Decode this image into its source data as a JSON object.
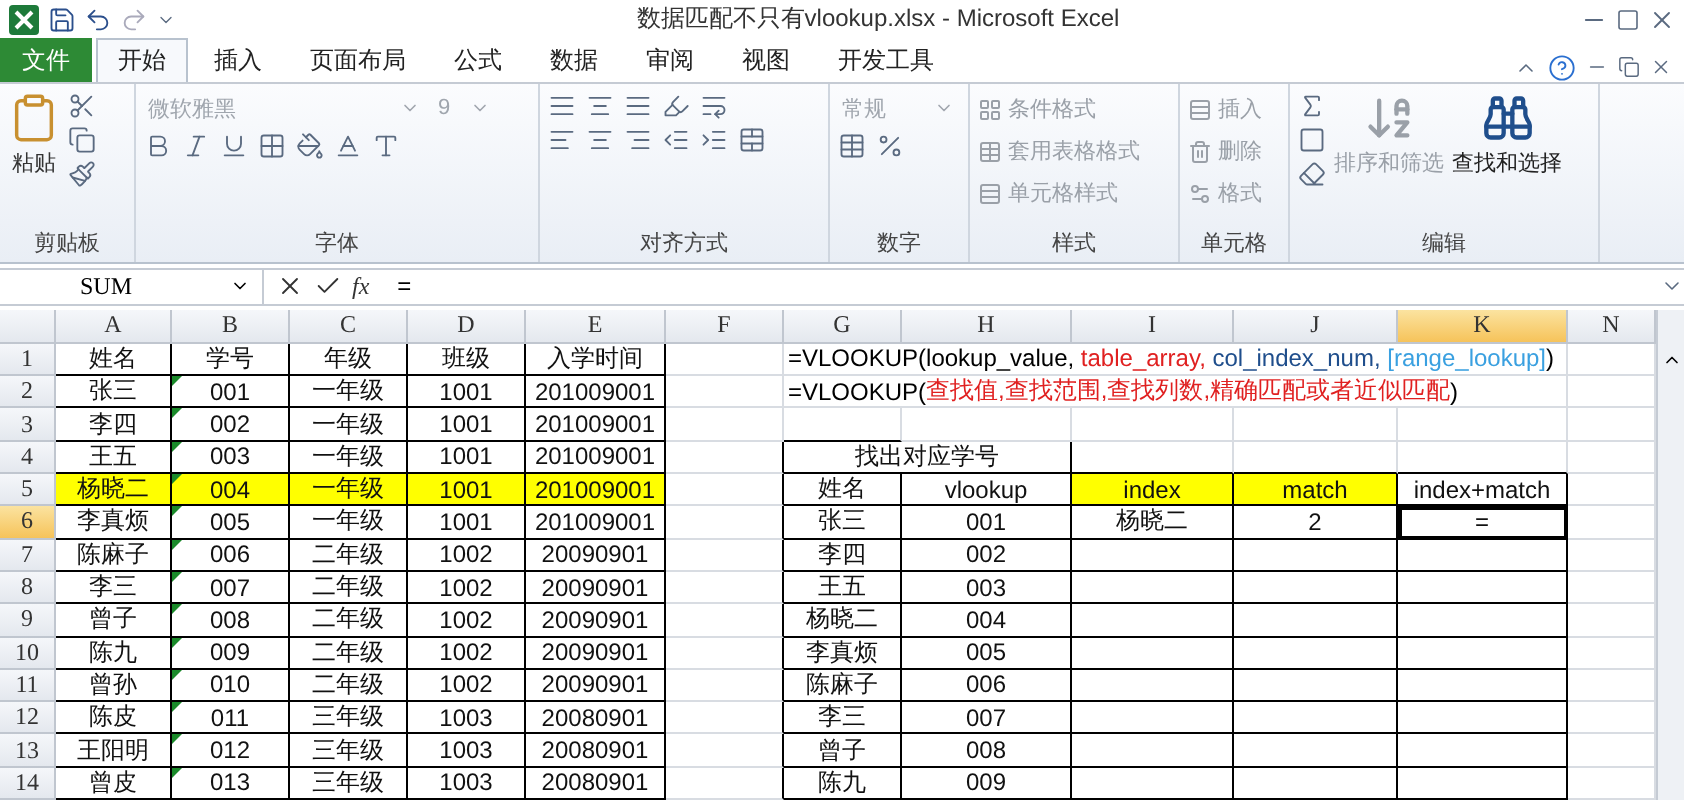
{
  "window": {
    "title": "数据匹配不只有vlookup.xlsx - Microsoft Excel"
  },
  "tabs": [
    {
      "label": "文件",
      "kind": "file",
      "selected": false
    },
    {
      "label": "开始",
      "kind": "tab",
      "selected": true
    },
    {
      "label": "插入",
      "kind": "tab",
      "selected": false
    },
    {
      "label": "页面布局",
      "kind": "tab",
      "selected": false
    },
    {
      "label": "公式",
      "kind": "tab",
      "selected": false
    },
    {
      "label": "数据",
      "kind": "tab",
      "selected": false
    },
    {
      "label": "审阅",
      "kind": "tab",
      "selected": false
    },
    {
      "label": "视图",
      "kind": "tab",
      "selected": false
    },
    {
      "label": "开发工具",
      "kind": "tab",
      "selected": false
    }
  ],
  "ribbon": [
    {
      "kind": "clipboard",
      "label": "剪贴板",
      "paste": "粘贴"
    },
    {
      "kind": "font",
      "label": "字体",
      "font_name": "微软雅黑",
      "font_size": "9"
    },
    {
      "kind": "alignment",
      "label": "对齐方式"
    },
    {
      "kind": "number",
      "label": "数字",
      "format": "常规"
    },
    {
      "kind": "list",
      "label": "样式",
      "items": [
        "条件格式",
        "套用表格格式",
        "单元格样式"
      ]
    },
    {
      "kind": "list",
      "label": "单元格",
      "items": [
        "插入",
        "删除",
        "格式"
      ]
    },
    {
      "kind": "editing",
      "label": "编辑",
      "items": [
        "排序和筛选",
        "查找和选择"
      ]
    }
  ],
  "formula_bar": {
    "name_box": "SUM",
    "insert_function": "fx",
    "value": "="
  },
  "columns": [
    {
      "label": "A",
      "selected": false
    },
    {
      "label": "B",
      "selected": false
    },
    {
      "label": "C",
      "selected": false
    },
    {
      "label": "D",
      "selected": false
    },
    {
      "label": "E",
      "selected": false
    },
    {
      "label": "F",
      "selected": false
    },
    {
      "label": "G",
      "selected": false
    },
    {
      "label": "H",
      "selected": false
    },
    {
      "label": "I",
      "selected": false
    },
    {
      "label": "J",
      "selected": false
    },
    {
      "label": "K",
      "selected": true
    },
    {
      "label": "N",
      "selected": false
    }
  ],
  "row_headers": [
    {
      "label": "1",
      "selected": false
    },
    {
      "label": "2",
      "selected": false
    },
    {
      "label": "3",
      "selected": false
    },
    {
      "label": "4",
      "selected": false
    },
    {
      "label": "5",
      "selected": false
    },
    {
      "label": "6",
      "selected": true
    },
    {
      "label": "7",
      "selected": false
    },
    {
      "label": "8",
      "selected": false
    },
    {
      "label": "9",
      "selected": false
    },
    {
      "label": "10",
      "selected": false
    },
    {
      "label": "11",
      "selected": false
    },
    {
      "label": "12",
      "selected": false
    },
    {
      "label": "13",
      "selected": false
    },
    {
      "label": "14",
      "selected": false
    }
  ],
  "left_table": [
    {
      "cells": [
        "姓名",
        "学号",
        "年级",
        "班级",
        "入学时间"
      ],
      "highlighted": false,
      "flagged": false
    },
    {
      "cells": [
        "张三",
        "001",
        "一年级",
        "1001",
        "201009001"
      ],
      "highlighted": false,
      "flagged": true
    },
    {
      "cells": [
        "李四",
        "002",
        "一年级",
        "1001",
        "201009001"
      ],
      "highlighted": false,
      "flagged": true
    },
    {
      "cells": [
        "王五",
        "003",
        "一年级",
        "1001",
        "201009001"
      ],
      "highlighted": false,
      "flagged": true
    },
    {
      "cells": [
        "杨晓二",
        "004",
        "一年级",
        "1001",
        "201009001"
      ],
      "highlighted": true,
      "flagged": true
    },
    {
      "cells": [
        "李真烦",
        "005",
        "一年级",
        "1001",
        "201009001"
      ],
      "highlighted": false,
      "flagged": true
    },
    {
      "cells": [
        "陈麻子",
        "006",
        "二年级",
        "1002",
        "20090901"
      ],
      "highlighted": false,
      "flagged": true
    },
    {
      "cells": [
        "李三",
        "007",
        "二年级",
        "1002",
        "20090901"
      ],
      "highlighted": false,
      "flagged": true
    },
    {
      "cells": [
        "曾子",
        "008",
        "二年级",
        "1002",
        "20090901"
      ],
      "highlighted": false,
      "flagged": true
    },
    {
      "cells": [
        "陈九",
        "009",
        "二年级",
        "1002",
        "20090901"
      ],
      "highlighted": false,
      "flagged": true
    },
    {
      "cells": [
        "曾孙",
        "010",
        "二年级",
        "1002",
        "20090901"
      ],
      "highlighted": false,
      "flagged": true
    },
    {
      "cells": [
        "陈皮",
        "011",
        "三年级",
        "1003",
        "20080901"
      ],
      "highlighted": false,
      "flagged": true
    },
    {
      "cells": [
        "王阳明",
        "012",
        "三年级",
        "1003",
        "20080901"
      ],
      "highlighted": false,
      "flagged": true
    },
    {
      "cells": [
        "曾皮",
        "013",
        "三年级",
        "1003",
        "20080901"
      ],
      "highlighted": false,
      "flagged": true
    }
  ],
  "formula_notes": [
    [
      {
        "text": "=VLOOKUP(lookup_value, ",
        "color": "#000000"
      },
      {
        "text": "table_array, ",
        "color": "#e02020"
      },
      {
        "text": "col_index_num, ",
        "color": "#1f4e8c"
      },
      {
        "text": "[range_lookup]",
        "color": "#3aa0e0"
      },
      {
        "text": ")",
        "color": "#000000"
      }
    ],
    [
      {
        "text": "=VLOOKUP(",
        "color": "#000000"
      },
      {
        "text": "查找值,查找范围,查找列数,精确匹配或者近似匹配",
        "color": "#e02020"
      },
      {
        "text": ")",
        "color": "#000000"
      }
    ]
  ],
  "right_table": {
    "title": "找出对应学号",
    "headers": [
      {
        "text": "姓名",
        "highlighted": false
      },
      {
        "text": "vlookup",
        "highlighted": false
      },
      {
        "text": "index",
        "highlighted": true
      },
      {
        "text": "match",
        "highlighted": true
      },
      {
        "text": "index+match",
        "highlighted": false
      }
    ],
    "rows": [
      [
        "张三",
        "001",
        "杨晓二",
        "2",
        "="
      ],
      [
        "李四",
        "002",
        "",
        "",
        ""
      ],
      [
        "王五",
        "003",
        "",
        "",
        ""
      ],
      [
        "杨晓二",
        "004",
        "",
        "",
        ""
      ],
      [
        "李真烦",
        "005",
        "",
        "",
        ""
      ],
      [
        "陈麻子",
        "006",
        "",
        "",
        ""
      ],
      [
        "李三",
        "007",
        "",
        "",
        ""
      ],
      [
        "曾子",
        "008",
        "",
        "",
        ""
      ],
      [
        "陈九",
        "009",
        "",
        "",
        ""
      ]
    ]
  }
}
